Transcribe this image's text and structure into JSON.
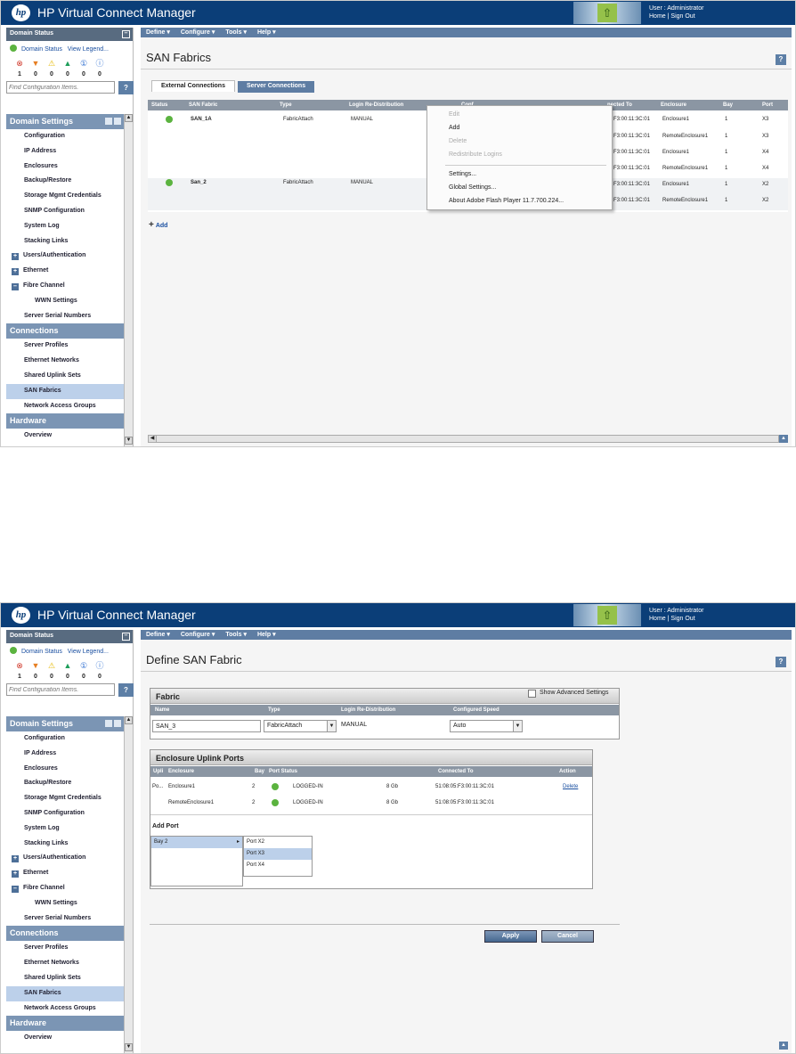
{
  "app": {
    "title": "HP Virtual Connect Manager",
    "logo": "hp",
    "user_line": "User : Administrator",
    "home": "Home",
    "sign_out": "Sign Out",
    "banner_icon": "up-arrow-icon",
    "accent": "#0b3e78"
  },
  "menu": [
    "Define ▾",
    "Configure ▾",
    "Tools ▾",
    "Help ▾"
  ],
  "domain_status": {
    "title": "Domain Status",
    "status_link": "Domain Status",
    "legend_link": "View Legend...",
    "icons": [
      "⊗",
      "▼",
      "⚠",
      "▲",
      "①",
      "ⓘ"
    ],
    "counts": [
      "1",
      "0",
      "0",
      "0",
      "0",
      "0"
    ]
  },
  "search": {
    "placeholder": "Find Configuration Items."
  },
  "help": "?",
  "sections": {
    "domain_settings": "Domain Settings",
    "connections": "Connections",
    "hardware": "Hardware"
  },
  "nav": {
    "domain": [
      "Configuration",
      "IP Address",
      "Enclosures",
      "Backup/Restore",
      "Storage Mgmt Credentials",
      "SNMP Configuration",
      "System Log",
      "Stacking Links"
    ],
    "tree": [
      "Users/Authentication",
      "Ethernet",
      "Fibre Channel"
    ],
    "wwn": "WWN Settings",
    "serial": "Server Serial Numbers",
    "connections": [
      "Server Profiles",
      "Ethernet Networks",
      "Shared Uplink Sets",
      "SAN Fabrics",
      "Network Access Groups"
    ],
    "hardware": [
      "Overview"
    ]
  },
  "screen1": {
    "title": "SAN Fabrics",
    "tabs": [
      "External Connections",
      "Server Connections"
    ],
    "columns": [
      "Status",
      "SAN Fabric",
      "Type",
      "Login Re-Distribution",
      "Conf",
      "nected To",
      "Enclosure",
      "Bay",
      "Port"
    ],
    "fabrics": [
      {
        "name": "SAN_1A",
        "type": "FabricAttach",
        "login": "MANUAL"
      },
      {
        "name": "San_2",
        "type": "FabricAttach",
        "login": "MANUAL"
      }
    ],
    "connections": [
      {
        "to": "F3:00:11:3C:01",
        "enclosure": "Enclosure1",
        "bay": "1",
        "port": "X3"
      },
      {
        "to": "F3:00:11:3C:01",
        "enclosure": "RemoteEnclosure1",
        "bay": "1",
        "port": "X3"
      },
      {
        "to": "F3:00:11:3C:01",
        "enclosure": "Enclosure1",
        "bay": "1",
        "port": "X4"
      },
      {
        "to": "F3:00:11:3C:01",
        "enclosure": "RemoteEnclosure1",
        "bay": "1",
        "port": "X4"
      },
      {
        "to": "F3:00:11:3C:01",
        "enclosure": "Enclosure1",
        "bay": "1",
        "port": "X2"
      },
      {
        "to": "F3:00:11:3C:01",
        "enclosure": "RemoteEnclosure1",
        "bay": "1",
        "port": "X2"
      }
    ],
    "add": "Add",
    "context_menu": [
      "Edit",
      "Add",
      "Delete",
      "Redistribute Logins",
      "Settings...",
      "Global Settings...",
      "About Adobe Flash Player 11.7.700.224..."
    ]
  },
  "screen2": {
    "title": "Define SAN Fabric",
    "fabric_box": "Fabric",
    "fabric_cols": [
      "Name",
      "Type",
      "Login Re-Distribution",
      "Configured Speed"
    ],
    "name_value": "SAN_3",
    "type_value": "FabricAttach",
    "login_value": "MANUAL",
    "speed_value": "Auto",
    "advanced": "Show Advanced Settings",
    "uplink_box": "Enclosure Uplink Ports",
    "uplink_cols": [
      "Upli",
      "Enclosure",
      "Bay",
      "Port Status",
      "Connected To",
      "Action"
    ],
    "uplinks": [
      {
        "upl": "Po...",
        "enclosure": "Enclosure1",
        "bay": "2",
        "status": "LOGGED-IN",
        "speed": "8 Gb",
        "to": "51:08:05:F3:00:11:3C:01",
        "action": "Delete"
      },
      {
        "upl": "",
        "enclosure": "RemoteEnclosure1",
        "bay": "2",
        "status": "LOGGED-IN",
        "speed": "8 Gb",
        "to": "51:08:05:F3:00:11:3C:01",
        "action": ""
      }
    ],
    "add_port": "Add Port",
    "bay_selected": "Bay 2",
    "ports": [
      "Port X2",
      "Port X3",
      "Port X4"
    ],
    "apply": "Apply",
    "cancel": "Cancel"
  }
}
